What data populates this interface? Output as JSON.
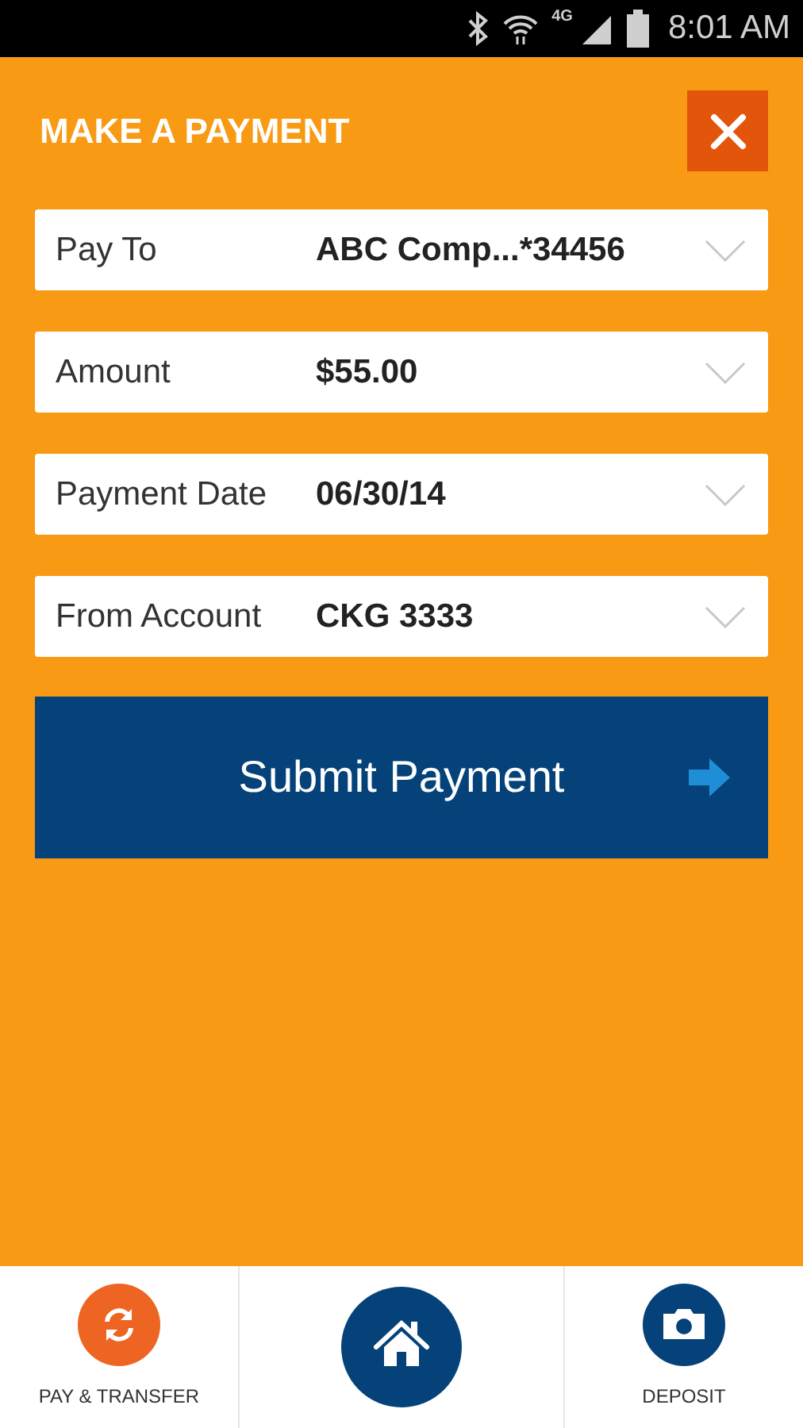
{
  "status_bar": {
    "network": "4G",
    "time": "8:01 AM"
  },
  "header": {
    "title": "MAKE A PAYMENT"
  },
  "fields": [
    {
      "label": "Pay To",
      "value": "ABC Comp...*34456"
    },
    {
      "label": "Amount",
      "value": "$55.00"
    },
    {
      "label": "Payment Date",
      "value": "06/30/14"
    },
    {
      "label": "From Account",
      "value": "CKG 3333"
    }
  ],
  "submit": {
    "label": "Submit Payment"
  },
  "nav": [
    {
      "kind": "pay",
      "label": "PAY & TRANSFER"
    },
    {
      "kind": "home"
    },
    {
      "kind": "deposit",
      "label": "DEPOSIT"
    }
  ]
}
